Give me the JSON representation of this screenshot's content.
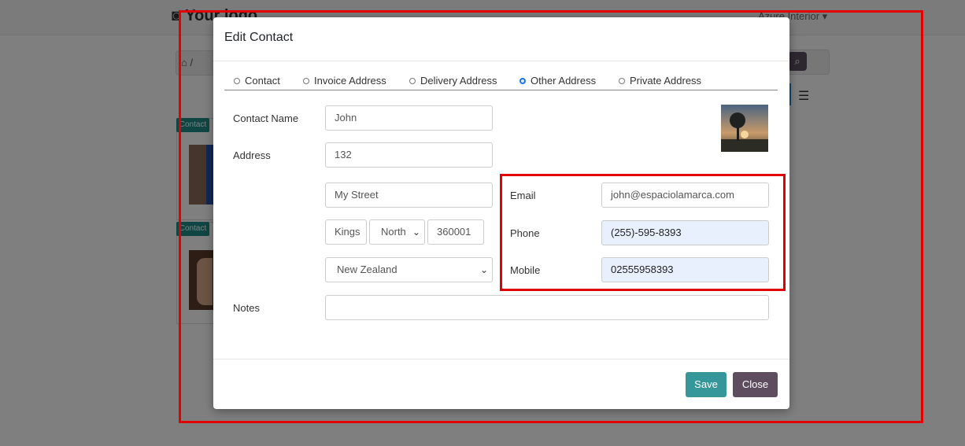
{
  "background": {
    "logo_text": "Your logo",
    "user_menu": "Azure Interior",
    "breadcrumb_home_sep": "/",
    "card_tag": "Contact"
  },
  "modal": {
    "title": "Edit Contact",
    "tabs": [
      {
        "label": "Contact",
        "selected": false
      },
      {
        "label": "Invoice Address",
        "selected": false
      },
      {
        "label": "Delivery Address",
        "selected": false
      },
      {
        "label": "Other Address",
        "selected": true
      },
      {
        "label": "Private Address",
        "selected": false
      }
    ],
    "labels": {
      "contact_name": "Contact Name",
      "address": "Address",
      "notes": "Notes",
      "email": "Email",
      "phone": "Phone",
      "mobile": "Mobile"
    },
    "values": {
      "contact_name": "John",
      "street_number": "132",
      "street": "My Street",
      "city": "Kings",
      "state": "North",
      "zip": "360001",
      "country": "New Zealand",
      "email": "john@espaciolamarca.com",
      "phone": "(255)-595-8393",
      "mobile": "02555958393",
      "notes": ""
    },
    "buttons": {
      "save": "Save",
      "close": "Close"
    }
  },
  "colors": {
    "highlight": "#e30000",
    "save_button": "#36979a",
    "close_button": "#5d4d5f",
    "autofill_bg": "#e8f0fe",
    "radio_selected": "#1a73e8"
  }
}
